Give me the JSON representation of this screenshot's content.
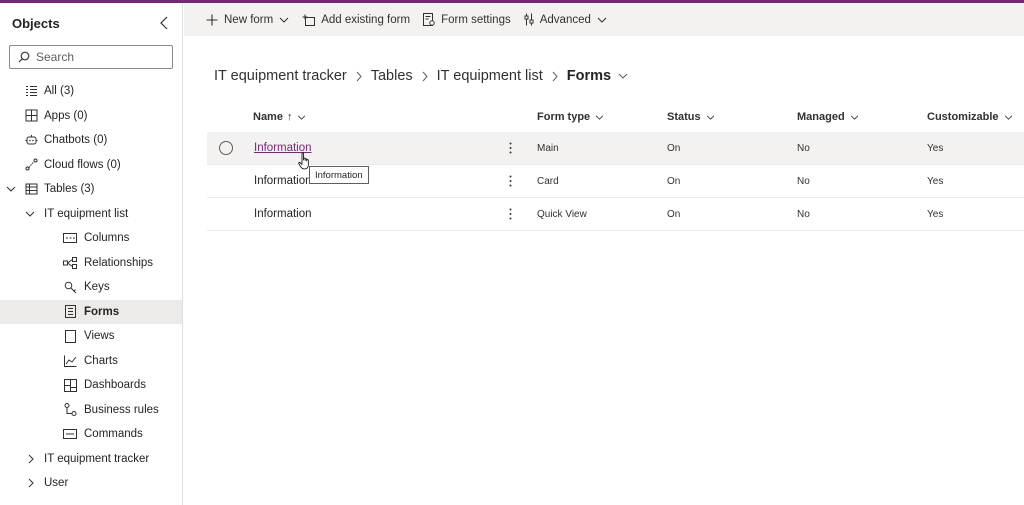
{
  "sidebar": {
    "title": "Objects",
    "search_placeholder": "Search",
    "items": [
      {
        "label": "All",
        "count": "(3)"
      },
      {
        "label": "Apps",
        "count": "(0)"
      },
      {
        "label": "Chatbots",
        "count": "(0)"
      },
      {
        "label": "Cloud flows",
        "count": "(0)"
      },
      {
        "label": "Tables",
        "count": "(3)"
      },
      {
        "label": "IT equipment list"
      },
      {
        "label": "Columns"
      },
      {
        "label": "Relationships"
      },
      {
        "label": "Keys"
      },
      {
        "label": "Forms"
      },
      {
        "label": "Views"
      },
      {
        "label": "Charts"
      },
      {
        "label": "Dashboards"
      },
      {
        "label": "Business rules"
      },
      {
        "label": "Commands"
      },
      {
        "label": "IT equipment tracker"
      },
      {
        "label": "User"
      }
    ]
  },
  "commandbar": {
    "new_form": "New form",
    "add_existing_form": "Add existing form",
    "form_settings": "Form settings",
    "advanced": "Advanced"
  },
  "breadcrumb": [
    "IT equipment tracker",
    "Tables",
    "IT equipment list",
    "Forms"
  ],
  "table": {
    "columns": [
      "Name",
      "Form type",
      "Status",
      "Managed",
      "Customizable"
    ],
    "sort_indicator": "↑",
    "rows": [
      {
        "name": "Information",
        "form_type": "Main",
        "status": "On",
        "managed": "No",
        "customizable": "Yes"
      },
      {
        "name": "Information",
        "form_type": "Card",
        "status": "On",
        "managed": "No",
        "customizable": "Yes"
      },
      {
        "name": "Information",
        "form_type": "Quick View",
        "status": "On",
        "managed": "No",
        "customizable": "Yes"
      }
    ]
  },
  "tooltip": "Information",
  "colors": {
    "accent": "#742774",
    "commandbar_bg": "#f3f2f1",
    "selected_bg": "#edebe9"
  }
}
